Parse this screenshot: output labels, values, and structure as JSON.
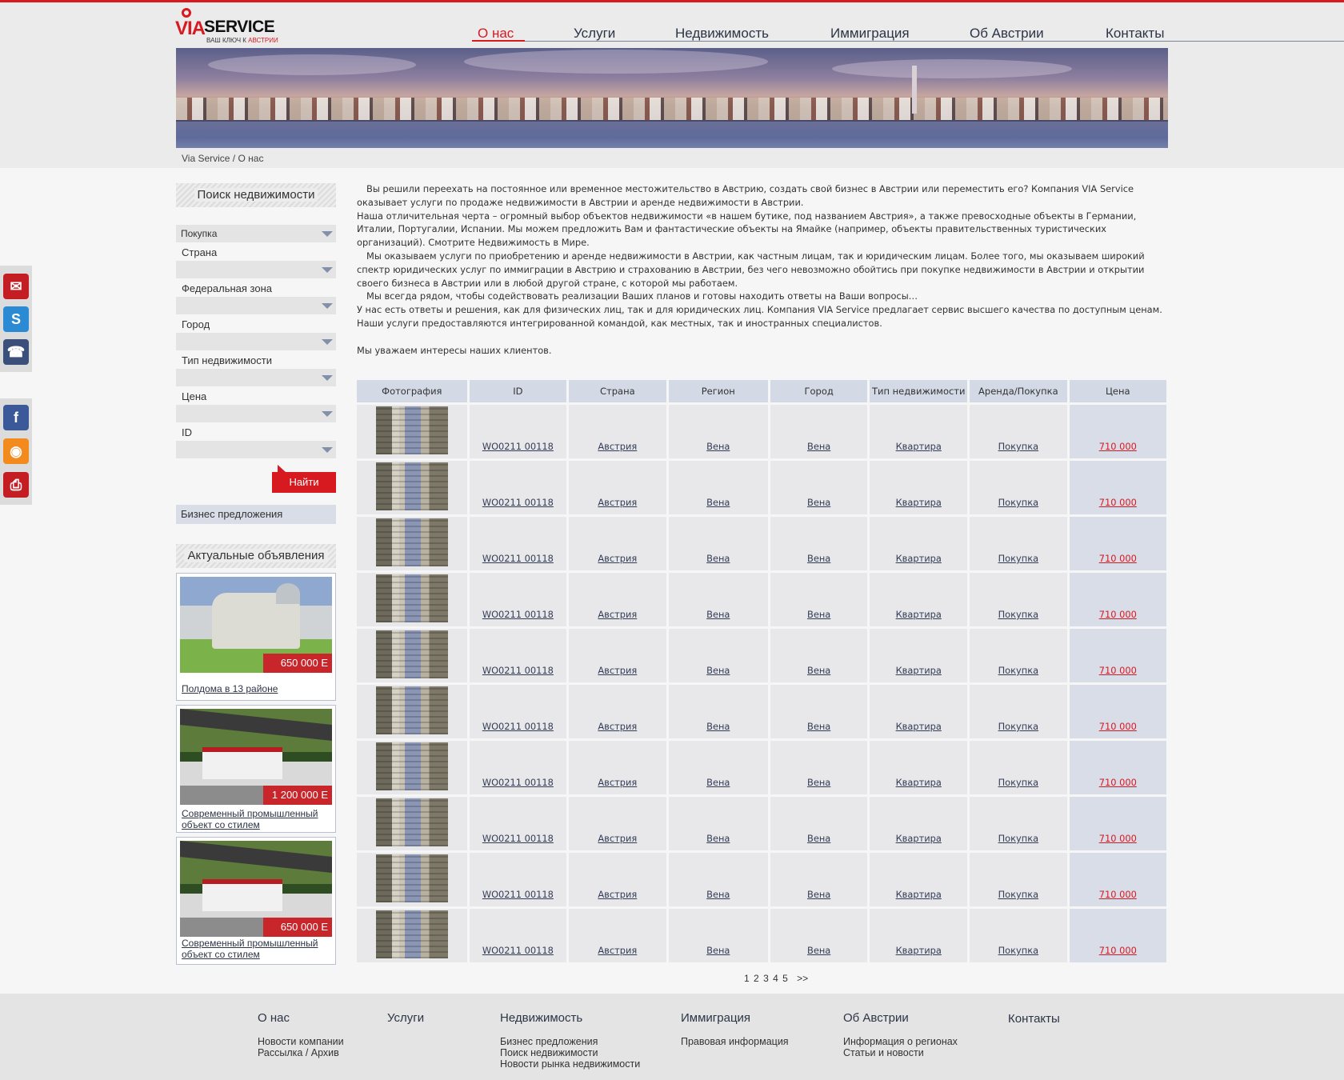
{
  "logo": {
    "word": "SERVICE",
    "prefix": "VIA",
    "tagline_1": "ВАШ КЛЮЧ К ",
    "tagline_2": "АВСТРИИ"
  },
  "nav": [
    "О нас",
    "Услуги",
    "Недвижимость",
    "Иммиграция",
    "Об Австрии",
    "Контакты"
  ],
  "breadcrumb": "Via Service / О нас",
  "search": {
    "title": "Поиск недвижимости",
    "deal_type": "Покупка",
    "labels": [
      "Страна",
      "Федеральная зона",
      "Город",
      "Тип недвижимости",
      "Цена",
      "ID"
    ],
    "button": "Найти",
    "business_link": "Бизнес предложения"
  },
  "ads": {
    "title": "Актуальные объявления",
    "items": [
      {
        "price": "650 000 E",
        "title_1": "Полдома в 13 районе",
        "title_2": ""
      },
      {
        "price": "1 200 000 E",
        "title_1": "Современный промышленный ",
        "title_2": "объект со стилем"
      },
      {
        "price": "650 000 E",
        "title_1": "Современный промышленный ",
        "title_2": "объект со стилем"
      }
    ]
  },
  "intro": [
    "Вы решили переехать на постоянное или временное местожительство в Австрию, создать свой бизнес в Австрии или переместить его? Компания VIA Service оказывает услуги по продаже недвижимости в Австрии и аренде недвижимости в Австрии.",
    "Наша отличительная черта – огромный выбор объектов недвижимости «в нашем бутике, под названием Австрия», а также превосходные объекты в Германии, Италии, Португалии, Испании. Мы можем предложить Вам и фантастические объекты на Ямайке (например, объекты правительственных туристических организаций). Смотрите Недвижимость в Мире.",
    "Мы оказываем услуги по приобретению и аренде недвижимости в Австрии, как частным лицам, так и юридическим лицам. Более того, мы оказываем широкий спектр юридических услуг по иммиграции в Австрию и страхованию в Австрии, без чего невозможно обойтись при покупке недвижимости в Австрии и открытии своего бизнеса в Австрии или в любой другой стране, с которой мы работаем.",
    "Мы всегда рядом, чтобы содействовать реализации Ваших планов и готовы находить ответы на Ваши вопросы…",
    "У нас есть ответы и решения, как для физических лиц, так и для юридических лиц. Компания VIA Service предлагает сервис высшего качества по доступным ценам. Наши услуги предоставляются интегрированной командой, как местных, так и иностранных специалистов.",
    "Мы уважаем интересы наших клиентов."
  ],
  "table": {
    "headers": [
      "Фотография",
      "ID",
      "Страна",
      "Регион",
      "Город",
      "Тип недвижимости",
      "Аренда/Покупка",
      "Цена"
    ],
    "rows": [
      {
        "id": "WO0211 00118",
        "country": "Австрия",
        "region": "Вена",
        "city": "Вена",
        "type": "Квартира",
        "deal": "Покупка",
        "price": "710 000"
      },
      {
        "id": "WO0211 00118",
        "country": "Австрия",
        "region": "Вена",
        "city": "Вена",
        "type": "Квартира",
        "deal": "Покупка",
        "price": "710 000"
      },
      {
        "id": "WO0211 00118",
        "country": "Австрия",
        "region": "Вена",
        "city": "Вена",
        "type": "Квартира",
        "deal": "Покупка",
        "price": "710 000"
      },
      {
        "id": "WO0211 00118",
        "country": "Австрия",
        "region": "Вена",
        "city": "Вена",
        "type": "Квартира",
        "deal": "Покупка",
        "price": "710 000"
      },
      {
        "id": "WO0211 00118",
        "country": "Австрия",
        "region": "Вена",
        "city": "Вена",
        "type": "Квартира",
        "deal": "Покупка",
        "price": "710 000"
      },
      {
        "id": "WO0211 00118",
        "country": "Австрия",
        "region": "Вена",
        "city": "Вена",
        "type": "Квартира",
        "deal": "Покупка",
        "price": "710 000"
      },
      {
        "id": "WO0211 00118",
        "country": "Австрия",
        "region": "Вена",
        "city": "Вена",
        "type": "Квартира",
        "deal": "Покупка",
        "price": "710 000"
      },
      {
        "id": "WO0211 00118",
        "country": "Австрия",
        "region": "Вена",
        "city": "Вена",
        "type": "Квартира",
        "deal": "Покупка",
        "price": "710 000"
      },
      {
        "id": "WO0211 00118",
        "country": "Австрия",
        "region": "Вена",
        "city": "Вена",
        "type": "Квартира",
        "deal": "Покупка",
        "price": "710 000"
      },
      {
        "id": "WO0211 00118",
        "country": "Австрия",
        "region": "Вена",
        "city": "Вена",
        "type": "Квартира",
        "deal": "Покупка",
        "price": "710 000"
      }
    ]
  },
  "pager": {
    "pages": [
      "1",
      "2",
      "3",
      "4",
      "5"
    ],
    "next": ">>"
  },
  "footer": [
    {
      "title": "О нас",
      "links": [
        "Новости компании",
        "Рассылка / Архив"
      ]
    },
    {
      "title": "Услуги",
      "links": []
    },
    {
      "title": "Недвижимость",
      "links": [
        "Бизнес предложения",
        "Поиск недвижимости",
        "Новости рынка недвижимости"
      ]
    },
    {
      "title": "Иммиграция",
      "links": [
        "Правовая информация"
      ]
    },
    {
      "title": "Об Австрии",
      "links": [
        "Информация о регионах",
        "Статьи и новости"
      ]
    },
    {
      "title": "Контакты",
      "links": []
    }
  ],
  "social_icons": [
    "mail-icon",
    "skype-icon",
    "phone-icon",
    "facebook-icon",
    "rss-icon",
    "print-icon"
  ],
  "colors": {
    "accent": "#d71920",
    "link": "#333d55",
    "header_cell": "#d4d9e6"
  }
}
